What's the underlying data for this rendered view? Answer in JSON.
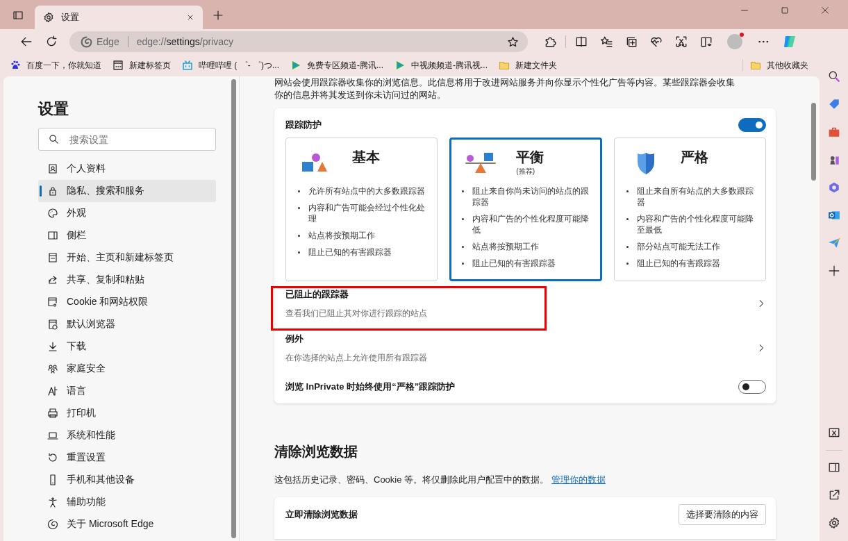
{
  "tabs": [
    {
      "title": "设置",
      "selected": true
    }
  ],
  "address_bar": {
    "site_label": "Edge",
    "url_prefix": "edge://",
    "url_host": "settings",
    "url_path": "/privacy"
  },
  "bookmarks": [
    {
      "label": "百度一下，你就知道",
      "kind": "baidu"
    },
    {
      "label": "新建标签页",
      "kind": "page"
    },
    {
      "label": "哔哩哔哩 ( ゜- ゜)つ...",
      "kind": "bilibili"
    },
    {
      "label": "免费专区频道-腾讯...",
      "kind": "video"
    },
    {
      "label": "中视频频道-腾讯视...",
      "kind": "video"
    },
    {
      "label": "新建文件夹",
      "kind": "folder"
    }
  ],
  "other_favorites": {
    "label": "其他收藏夹"
  },
  "settings": {
    "title": "设置",
    "search_placeholder": "搜索设置",
    "nav": [
      {
        "label": "个人资料",
        "kind": "profile",
        "selected": false
      },
      {
        "label": "隐私、搜索和服务",
        "kind": "lock",
        "selected": true
      },
      {
        "label": "外观",
        "kind": "palette",
        "selected": false
      },
      {
        "label": "侧栏",
        "kind": "sidebar",
        "selected": false
      },
      {
        "label": "开始、主页和新建标签页",
        "kind": "start",
        "selected": false
      },
      {
        "label": "共享、复制和粘贴",
        "kind": "share",
        "selected": false
      },
      {
        "label": "Cookie 和网站权限",
        "kind": "cookie",
        "selected": false
      },
      {
        "label": "默认浏览器",
        "kind": "browser",
        "selected": false
      },
      {
        "label": "下载",
        "kind": "download",
        "selected": false
      },
      {
        "label": "家庭安全",
        "kind": "family",
        "selected": false
      },
      {
        "label": "语言",
        "kind": "language",
        "selected": false
      },
      {
        "label": "打印机",
        "kind": "printer",
        "selected": false
      },
      {
        "label": "系统和性能",
        "kind": "laptop",
        "selected": false
      },
      {
        "label": "重置设置",
        "kind": "reset",
        "selected": false
      },
      {
        "label": "手机和其他设备",
        "kind": "phone",
        "selected": false
      },
      {
        "label": "辅助功能",
        "kind": "accessibility",
        "selected": false
      },
      {
        "label": "关于 Microsoft Edge",
        "kind": "edge",
        "selected": false
      }
    ]
  },
  "intro": [
    "网站会使用跟踪器收集你的浏览信息。此信息将用于改进网站服务并向你显示个性化广告等内容。某些跟踪器会收集",
    "你的信息并将其发送到你未访问过的网站。"
  ],
  "tracking": {
    "title": "跟踪防护",
    "on": true,
    "levels": [
      {
        "title": "基本",
        "kind": "shapes",
        "selected": false,
        "bullets": [
          "允许所有站点中的大多数跟踪器",
          "内容和广告可能会经过个性化处理",
          "站点将按预期工作",
          "阻止已知的有害跟踪器"
        ]
      },
      {
        "title": "平衡",
        "subtitle": "(推荐)",
        "kind": "balance",
        "selected": true,
        "bullets": [
          "阻止来自你尚未访问的站点的跟踪器",
          "内容和广告的个性化程度可能降低",
          "站点将按预期工作",
          "阻止已知的有害跟踪器"
        ]
      },
      {
        "title": "严格",
        "kind": "shield",
        "selected": false,
        "bullets": [
          "阻止来自所有站点的大多数跟踪器",
          "内容和广告的个性化程度可能降至最低",
          "部分站点可能无法工作",
          "阻止已知的有害跟踪器"
        ]
      }
    ],
    "rows": [
      {
        "kind": "link",
        "title": "已阻止的跟踪器",
        "description": "查看我们已阻止其对你进行跟踪的站点",
        "highlighted": true
      },
      {
        "kind": "link",
        "title": "例外",
        "description": "在你选择的站点上允许使用所有跟踪器",
        "highlighted": false
      },
      {
        "kind": "toggle",
        "title": "浏览 InPrivate 时始终使用“严格”跟踪防护",
        "on": false,
        "highlighted": false
      }
    ]
  },
  "clear": {
    "heading": "清除浏览数据",
    "description": "这包括历史记录、密码、Cookie 等。将仅删除此用户配置中的数据。",
    "link": "管理你的数据",
    "card_title": "立即清除浏览数据",
    "button": "选择要清除的内容"
  }
}
